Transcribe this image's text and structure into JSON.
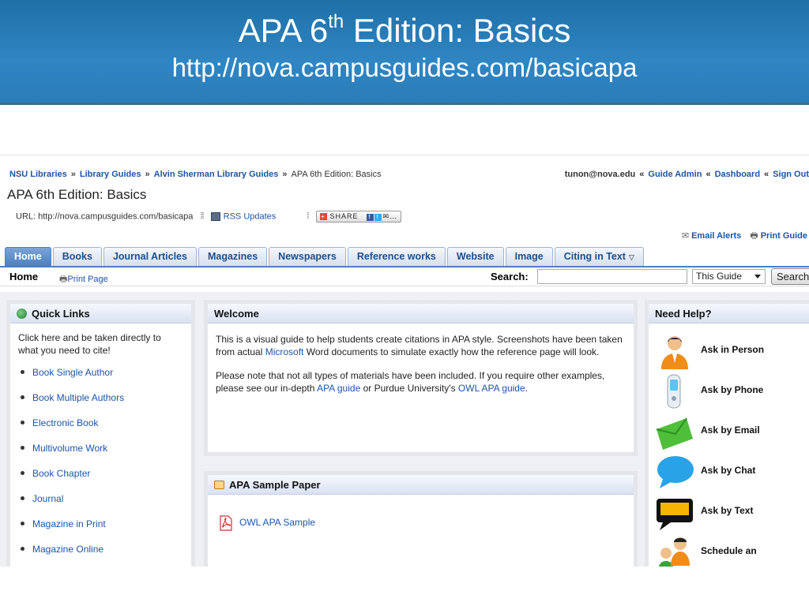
{
  "slide": {
    "title_main": "APA 6",
    "title_sup": "th",
    "title_rest": " Edition: Basics",
    "url": "http://nova.campusguides.com/basicapa"
  },
  "breadcrumb": {
    "items": [
      "NSU Libraries",
      "Library Guides",
      "Alvin Sherman Library Guides"
    ],
    "current": "APA 6th Edition: Basics",
    "separator": "»"
  },
  "userbar": {
    "email": "tunon@nova.edu",
    "links": [
      "Guide Admin",
      "Dashboard",
      "Sign Out"
    ],
    "separator": "«"
  },
  "guide": {
    "title": "APA 6th Edition: Basics",
    "url_text": "URL: http://nova.campusguides.com/basicapa",
    "rss_label": "RSS Updates",
    "share_label": "SHARE"
  },
  "alerts": {
    "email_alerts": "Email Alerts",
    "print_guide": "Print Guide"
  },
  "tabs": [
    {
      "label": "Home"
    },
    {
      "label": "Books"
    },
    {
      "label": "Journal Articles"
    },
    {
      "label": "Magazines"
    },
    {
      "label": "Newspapers"
    },
    {
      "label": "Reference works"
    },
    {
      "label": "Website"
    },
    {
      "label": "Image"
    },
    {
      "label": "Citing in Text"
    }
  ],
  "subbar": {
    "page": "Home",
    "print_page": "Print Page",
    "search_label": "Search:",
    "search_value": "",
    "scope": "This Guide",
    "search_button": "Search"
  },
  "quick_links": {
    "title": "Quick Links",
    "intro": "Click here and be taken directly to what you need to cite!",
    "items": [
      "Book Single Author",
      "Book Multiple Authors",
      "Electronic Book",
      "Multivolume Work",
      "Book Chapter",
      "Journal",
      "Magazine in Print",
      "Magazine Online"
    ]
  },
  "welcome": {
    "title": "Welcome",
    "p1_a": "This is a visual guide to help students create citations in APA style.  Screenshots have been taken from actual ",
    "p1_link": "Microsoft",
    "p1_b": " Word documents to simulate exactly how the reference page will look.",
    "p2_a": "Please note that not all types of materials have been included.  If you require other examples, please see our in-depth ",
    "p2_link1": "APA guide",
    "p2_b": " or Purdue University's ",
    "p2_link2": "OWL APA guide",
    "p2_c": "."
  },
  "sample": {
    "title": "APA Sample Paper",
    "link": "OWL APA Sample"
  },
  "help": {
    "title": "Need Help?",
    "items": [
      "Ask in Person",
      "Ask by Phone",
      "Ask by Email",
      "Ask by Chat",
      "Ask by Text",
      "Schedule an"
    ]
  },
  "colors": {
    "header_blue": "#2a7cb8",
    "link": "#1c55a8",
    "active_tab": "#4f7fc0"
  }
}
